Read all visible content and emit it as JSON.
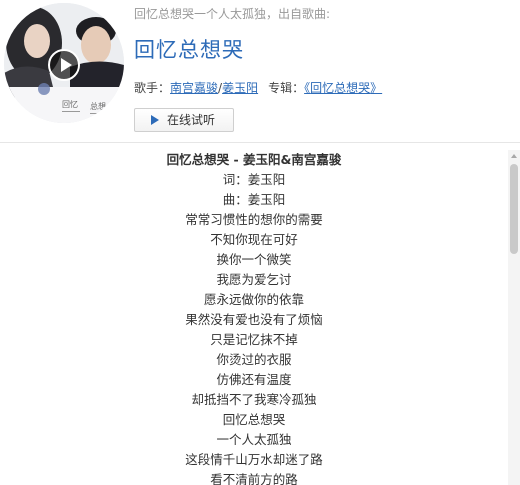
{
  "header": {
    "subtitle": "回忆总想哭一个人太孤独，出自歌曲:",
    "song_title": "回忆总想哭",
    "artist_prefix": "歌手：",
    "artist_1": "南宫嘉骏",
    "artist_sep": "/",
    "artist_2": "姜玉阳",
    "album_prefix": "专辑：",
    "album_open": "《",
    "album_name": "回忆总想哭",
    "album_close": "》",
    "listen_button": "在线试听"
  },
  "cover": {
    "icon": "play-icon",
    "caption_left": "回忆",
    "caption_right": "总想"
  },
  "lyrics": {
    "heading": "回忆总想哭 - 姜玉阳&南宫嘉骏",
    "lines": [
      "词：姜玉阳",
      "曲：姜玉阳",
      "常常习惯性的想你的需要",
      "不知你现在可好",
      "换你一个微笑",
      "我愿为爱乞讨",
      "愿永远做你的依靠",
      "果然没有爱也没有了烦恼",
      "只是记忆抹不掉",
      "你烫过的衣服",
      "仿佛还有温度",
      "却抵挡不了我寒冷孤独",
      "回忆总想哭",
      "一个人太孤独",
      "这段情千山万水却迷了路",
      "看不清前方的路"
    ]
  },
  "colors": {
    "link": "#2d6bb8",
    "title": "#2d6bb8",
    "subtitle": "#999999",
    "text": "#333333"
  }
}
